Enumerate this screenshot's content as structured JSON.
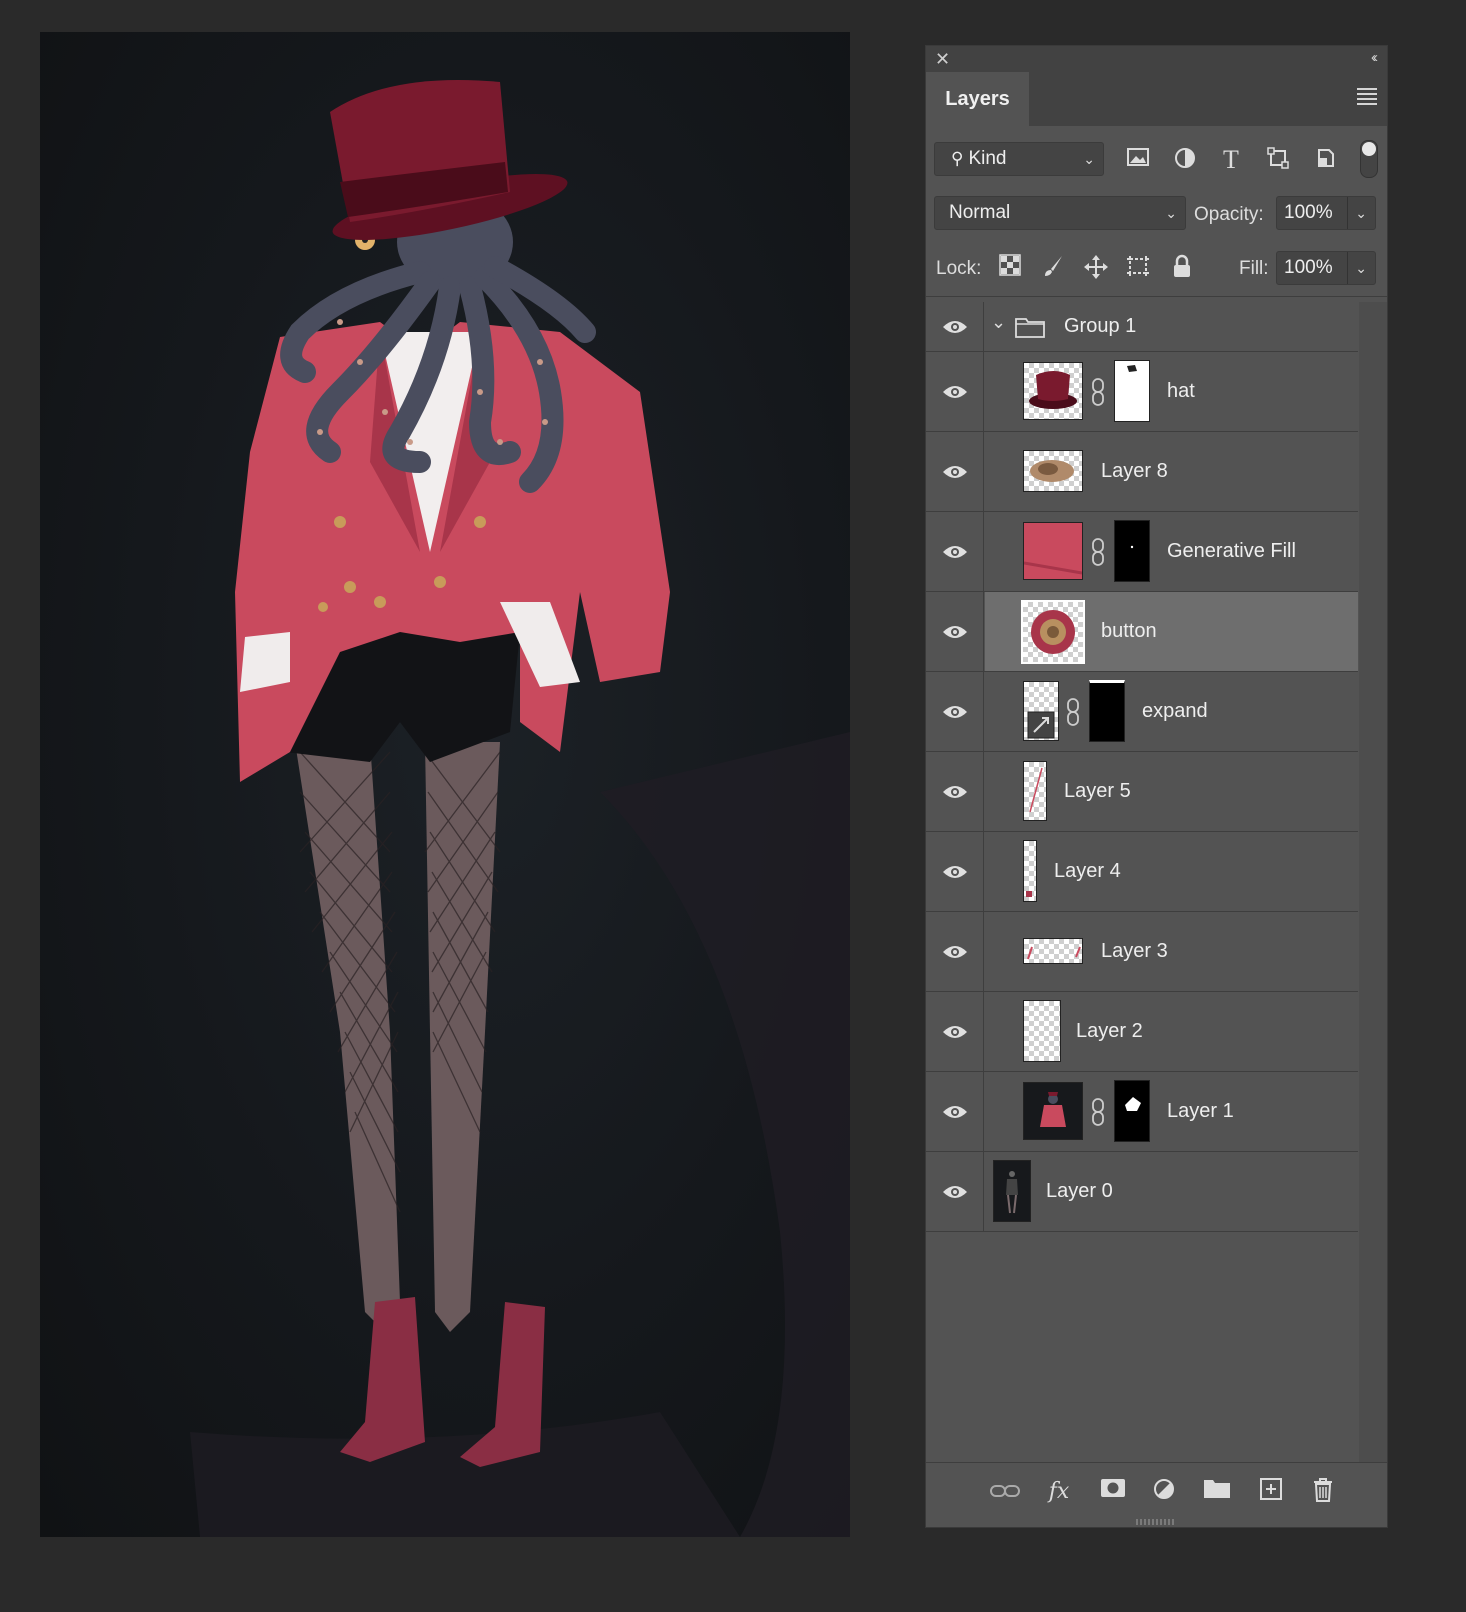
{
  "panel": {
    "tab_label": "Layers",
    "filter": {
      "kind_label": "Kind"
    },
    "blend_mode": "Normal",
    "opacity_label": "Opacity:",
    "opacity_value": "100%",
    "lock_label": "Lock:",
    "fill_label": "Fill:",
    "fill_value": "100%"
  },
  "group": {
    "name": "Group 1",
    "expanded": true
  },
  "layers": [
    {
      "name": "hat",
      "has_mask": true
    },
    {
      "name": "Layer 8",
      "has_mask": false
    },
    {
      "name": "Generative Fill",
      "has_mask": true
    },
    {
      "name": "button",
      "has_mask": false,
      "selected": true
    },
    {
      "name": "expand",
      "has_mask": true,
      "smart_object": true
    },
    {
      "name": "Layer 5",
      "has_mask": false
    },
    {
      "name": "Layer 4",
      "has_mask": false
    },
    {
      "name": "Layer 3",
      "has_mask": false
    },
    {
      "name": "Layer 2",
      "has_mask": false
    },
    {
      "name": "Layer 1",
      "has_mask": true
    },
    {
      "name": "Layer 0",
      "has_mask": false
    }
  ],
  "colors": {
    "panel_bg": "#535353",
    "selected_row": "#6e6e6e",
    "jacket": "#c94a5e",
    "hat": "#7a1a2e",
    "octopus": "#4a4d5e"
  }
}
